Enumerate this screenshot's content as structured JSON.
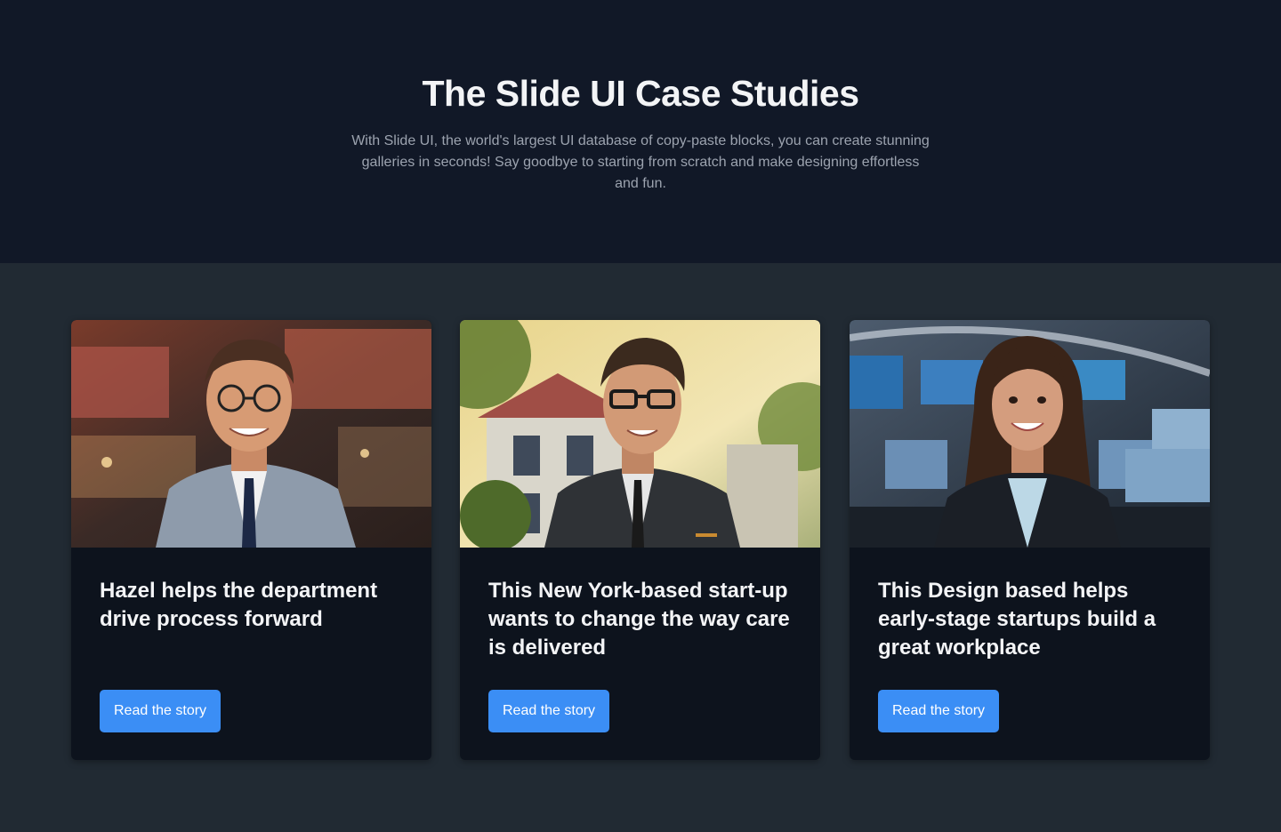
{
  "hero": {
    "title": "The Slide UI Case Studies",
    "subtitle": "With Slide UI, the world's largest UI database of copy-paste blocks, you can create stunning galleries in seconds! Say goodbye to starting from scratch and make designing effortless and fun."
  },
  "cards": [
    {
      "image": "smiling-man-glasses-office-photo",
      "title": "Hazel helps the department drive process forward",
      "button": "Read the story"
    },
    {
      "image": "smiling-man-glasses-house-photo",
      "title": "This New York-based start-up wants to change the way care is delivered",
      "button": "Read the story"
    },
    {
      "image": "smiling-woman-control-room-photo",
      "title": "This Design based helps early-stage startups build a great workplace",
      "button": "Read the story"
    }
  ],
  "colors": {
    "hero_bg": "#111827",
    "section_bg": "#212a33",
    "card_bg": "#0d131d",
    "button": "#3b8ef5"
  }
}
